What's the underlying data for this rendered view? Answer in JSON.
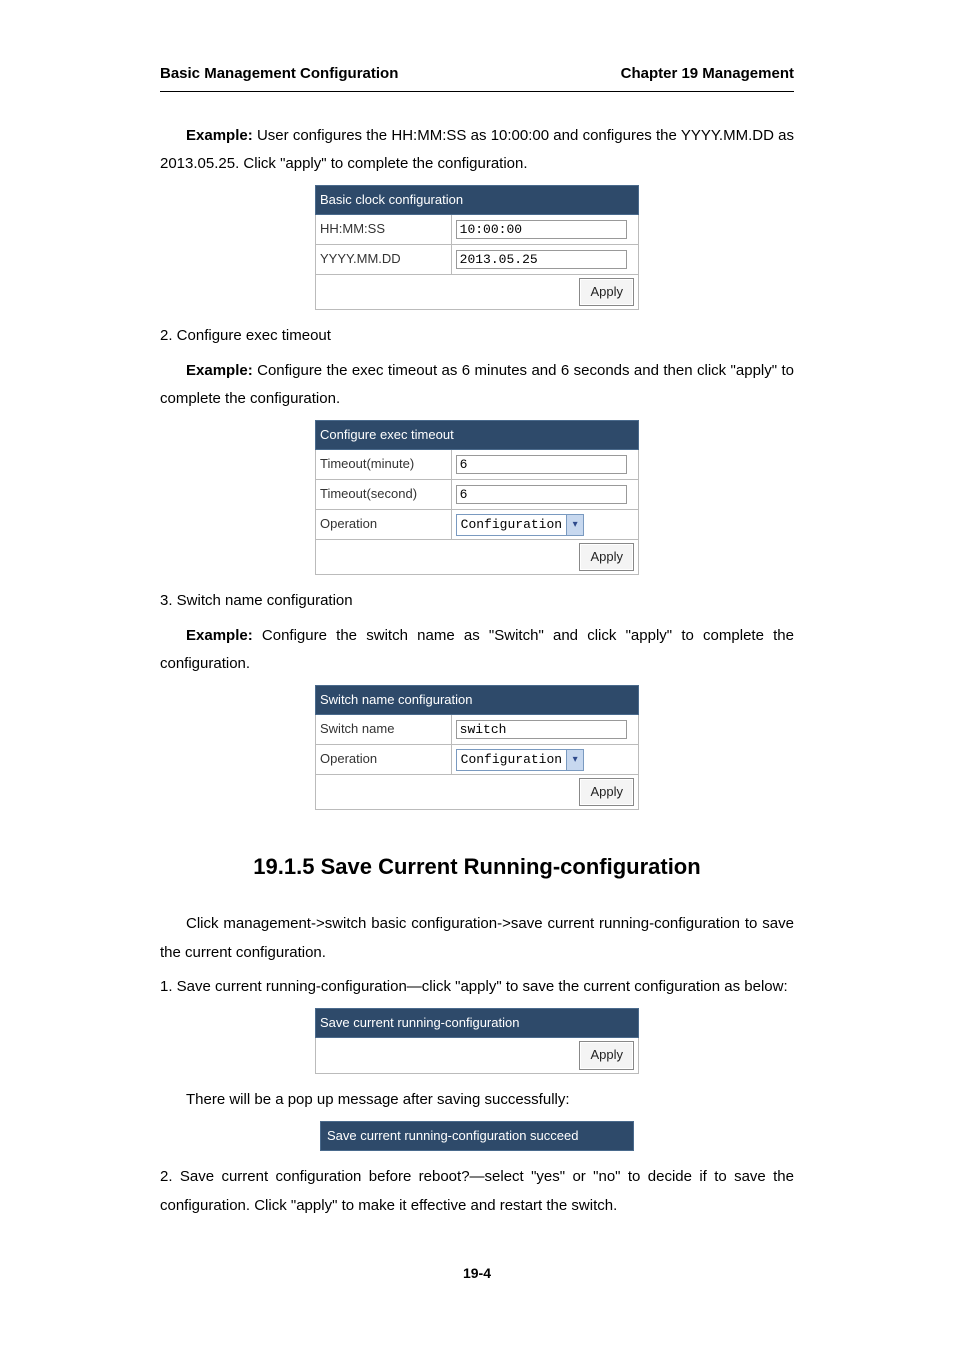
{
  "header": {
    "left": "Basic Management Configuration",
    "right": "Chapter 19 Management"
  },
  "p_example1_a": "Example:",
  "p_example1_b": " User configures the HH:MM:SS as 10:00:00 and configures the YYYY.MM.DD as 2013.05.25. Click \"apply\" to complete the configuration.",
  "table_clock": {
    "title": "Basic clock configuration",
    "row1_label": "HH:MM:SS",
    "row1_value": "10:00:00",
    "row2_label": "YYYY.MM.DD",
    "row2_value": "2013.05.25",
    "apply": "Apply"
  },
  "p_item2": "2. Configure exec timeout",
  "p_example2_a": "Example:",
  "p_example2_b": " Configure the exec timeout as 6 minutes and 6 seconds and then click \"apply\" to complete the configuration.",
  "table_timeout": {
    "title": "Configure exec timeout",
    "row1_label": "Timeout(minute)",
    "row1_value": "6",
    "row2_label": "Timeout(second)",
    "row2_value": "6",
    "row3_label": "Operation",
    "row3_value": "Configuration",
    "apply": "Apply"
  },
  "p_item3": "3. Switch name configuration",
  "p_example3_a": "Example:",
  "p_example3_b": " Configure the switch name as \"Switch\" and click \"apply\" to complete the configuration.",
  "table_switch": {
    "title": "Switch name configuration",
    "row1_label": "Switch name",
    "row1_value": "switch",
    "row2_label": "Operation",
    "row2_value": "Configuration",
    "apply": "Apply"
  },
  "section_title": "19.1.5 Save Current Running-configuration",
  "p_section_intro": "Click management->switch basic configuration->save current running-configuration to save the current configuration.",
  "p_section_item1": "1. Save current running-configuration—click \"apply\" to save the current configuration as below:",
  "table_save": {
    "title": "Save current running-configuration",
    "apply": "Apply"
  },
  "p_popup": "There will be a pop up message after saving successfully:",
  "succeed_msg": "Save current running-configuration succeed",
  "p_section_item2": "2. Save current configuration before reboot?—select \"yes\" or \"no\" to decide if to save the configuration. Click \"apply\" to make it effective and restart the switch.",
  "page_number": "19-4"
}
